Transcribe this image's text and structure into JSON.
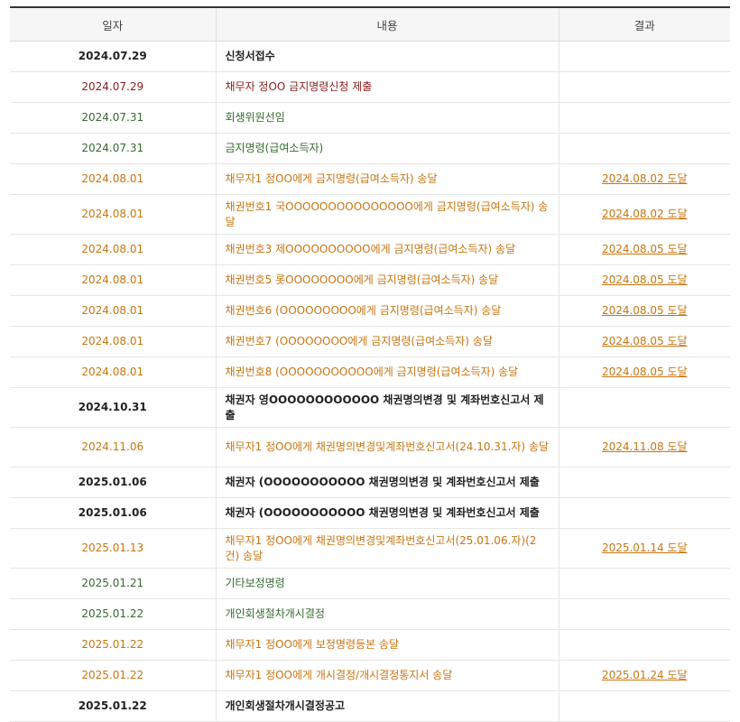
{
  "headers": {
    "date": "일자",
    "content": "내용",
    "result": "결과"
  },
  "rows": [
    {
      "date": "2024.07.29",
      "content": "신청서접수",
      "result": "",
      "color": "black",
      "tall": false
    },
    {
      "date": "2024.07.29",
      "content": "채무자 정OO 금지명령신청 제출",
      "result": "",
      "color": "maroon",
      "tall": false
    },
    {
      "date": "2024.07.31",
      "content": "회생위원선임",
      "result": "",
      "color": "green",
      "tall": false
    },
    {
      "date": "2024.07.31",
      "content": "금지명령(급여소득자)",
      "result": "",
      "color": "green",
      "tall": false
    },
    {
      "date": "2024.08.01",
      "content": "채무자1 정OO에게 금지명령(급여소득자) 송달",
      "result": "2024.08.02 도달",
      "color": "orange",
      "tall": false
    },
    {
      "date": "2024.08.01",
      "content": "채권번호1 국OOOOOOOOOOOOOOO에게 금지명령(급여소득자) 송달",
      "result": "2024.08.02 도달",
      "color": "orange",
      "tall": true
    },
    {
      "date": "2024.08.01",
      "content": "채권번호3 제OOOOOOOOOO에게 금지명령(급여소득자) 송달",
      "result": "2024.08.05 도달",
      "color": "orange",
      "tall": false
    },
    {
      "date": "2024.08.01",
      "content": "채권번호5 롯OOOOOOOO에게 금지명령(급여소득자) 송달",
      "result": "2024.08.05 도달",
      "color": "orange",
      "tall": false
    },
    {
      "date": "2024.08.01",
      "content": "채권번호6 (OOOOOOOOO에게 금지명령(급여소득자) 송달",
      "result": "2024.08.05 도달",
      "color": "orange",
      "tall": false
    },
    {
      "date": "2024.08.01",
      "content": "채권번호7 (OOOOOOOO에게 금지명령(급여소득자) 송달",
      "result": "2024.08.05 도달",
      "color": "orange",
      "tall": false
    },
    {
      "date": "2024.08.01",
      "content": "채권번호8 (OOOOOOOOOOO에게 금지명령(급여소득자) 송달",
      "result": "2024.08.05 도달",
      "color": "orange",
      "tall": false
    },
    {
      "date": "2024.10.31",
      "content": "채권자 영OOOOOOOOOOOO 채권명의변경 및 계좌번호신고서 제출",
      "result": "",
      "color": "black",
      "tall": true
    },
    {
      "date": "2024.11.06",
      "content": "채무자1 정OO에게 채권명의변경및계좌번호신고서(24.10.31.자) 송달",
      "result": "2024.11.08 도달",
      "color": "orange",
      "tall": true
    },
    {
      "date": "2025.01.06",
      "content": "채권자 (OOOOOOOOOOO 채권명의변경 및 계좌번호신고서 제출",
      "result": "",
      "color": "black",
      "tall": false
    },
    {
      "date": "2025.01.06",
      "content": "채권자 (OOOOOOOOOOO 채권명의변경 및 계좌번호신고서 제출",
      "result": "",
      "color": "black",
      "tall": false
    },
    {
      "date": "2025.01.13",
      "content": "채무자1 정OO에게 채권명의변경및계좌번호신고서(25.01.06.자)(2건) 송달",
      "result": "2025.01.14 도달",
      "color": "orange",
      "tall": true
    },
    {
      "date": "2025.01.21",
      "content": "기타보정명령",
      "result": "",
      "color": "green",
      "tall": false
    },
    {
      "date": "2025.01.22",
      "content": "개인회생절차개시결정",
      "result": "",
      "color": "green",
      "tall": false
    },
    {
      "date": "2025.01.22",
      "content": "채무자1 정OO에게 보정명령등본 송달",
      "result": "",
      "color": "orange",
      "tall": false
    },
    {
      "date": "2025.01.22",
      "content": "채무자1 정OO에게 개시결정/개시결정통지서 송달",
      "result": "2025.01.24 도달",
      "color": "orange",
      "tall": false
    },
    {
      "date": "2025.01.22",
      "content": "개인회생절차개시결정공고",
      "result": "",
      "color": "black",
      "tall": false
    }
  ]
}
